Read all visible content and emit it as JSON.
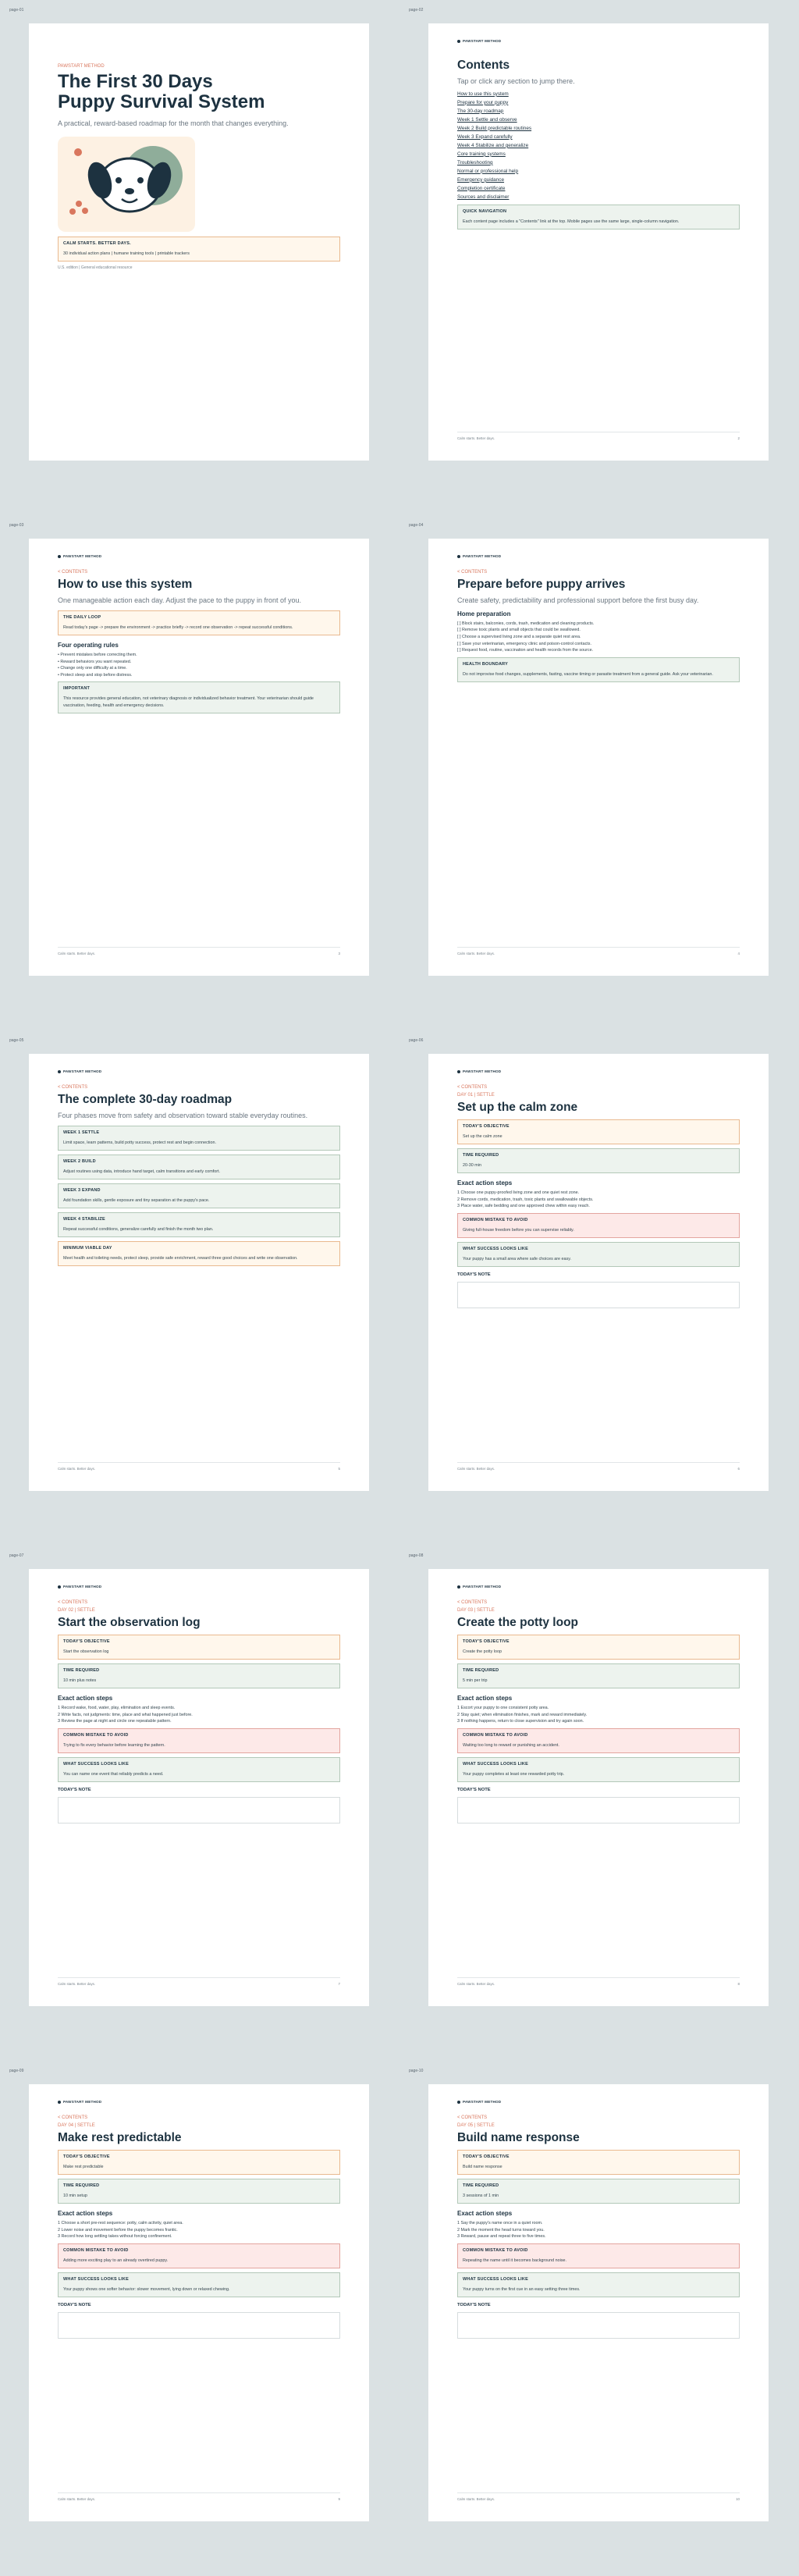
{
  "brand": "PAWSTART METHOD",
  "footer_left": "Calm starts. Better days.",
  "back_label": "< CONTENTS",
  "page_labels": [
    "page-01",
    "page-02",
    "page-03",
    "page-04",
    "page-05",
    "page-06",
    "page-07",
    "page-08",
    "page-09",
    "page-10"
  ],
  "cover": {
    "eyebrow": "PAWSTART METHOD",
    "title_line1": "The First 30 Days",
    "title_line2": "Puppy Survival System",
    "subtitle": "A practical, reward-based roadmap for the month that changes everything.",
    "callout_title": "CALM STARTS. BETTER DAYS.",
    "callout_body": "30 individual action plans | humane training tools | printable trackers",
    "edition": "U.S. edition | General educational resource"
  },
  "contents": {
    "title": "Contents",
    "subtitle": "Tap or click any section to jump there.",
    "items": [
      "How to use this system",
      "Prepare for your puppy",
      "The 30-day roadmap",
      "Week 1 Settle and observe",
      "Week 2 Build predictable routines",
      "Week 3 Expand carefully",
      "Week 4 Stabilize and generalize",
      "Core training systems",
      "Troubleshooting",
      "Normal or professional help",
      "Emergency guidance",
      "Completion certificate",
      "Sources and disclaimer"
    ],
    "box_title": "QUICK NAVIGATION",
    "box_body": "Each content page includes a \"Contents\" link at the top. Mobile pages use the same large, single-column navigation.",
    "page_num": "2"
  },
  "howto": {
    "title": "How to use this system",
    "subtitle": "One manageable action each day. Adjust the pace to the puppy in front of you.",
    "box1_title": "THE DAILY LOOP",
    "box1_body": "Read today's page -> prepare the environment -> practice briefly -> record one observation -> repeat successful conditions.",
    "rules_heading": "Four operating rules",
    "rules": [
      "Prevent mistakes before correcting them.",
      "Reward behaviors you want repeated.",
      "Change only one difficulty at a time.",
      "Protect sleep and stop before distress."
    ],
    "box2_title": "IMPORTANT",
    "box2_body": "This resource provides general education, not veterinary diagnosis or individualized behavior treatment. Your veterinarian should guide vaccination, feeding, health and emergency decisions.",
    "page_num": "3"
  },
  "prepare": {
    "title": "Prepare before puppy arrives",
    "subtitle": "Create safety, predictability and professional support before the first busy day.",
    "heading": "Home preparation",
    "items": [
      "Block stairs, balconies, cords, trash, medication and cleaning products.",
      "Remove toxic plants and small objects that could be swallowed.",
      "Choose a supervised living zone and a separate quiet rest area.",
      "Save your veterinarian, emergency clinic and poison-control contacts.",
      "Request food, routine, vaccination and health records from the source."
    ],
    "box_title": "HEALTH BOUNDARY",
    "box_body": "Do not improvise food changes, supplements, fasting, vaccine timing or parasite treatment from a general guide. Ask your veterinarian.",
    "page_num": "4"
  },
  "roadmap": {
    "title": "The complete 30-day roadmap",
    "subtitle": "Four phases move from safety and observation toward stable everyday routines.",
    "weeks": [
      {
        "title": "WEEK 1 SETTLE",
        "body": "Limit space, learn patterns, build potty success, protect rest and begin connection."
      },
      {
        "title": "WEEK 2 BUILD",
        "body": "Adjust routines using data, introduce hand target, calm transitions and early comfort."
      },
      {
        "title": "WEEK 3 EXPAND",
        "body": "Add foundation skills, gentle exposure and tiny separation at the puppy's pace."
      },
      {
        "title": "WEEK 4 STABILIZE",
        "body": "Repeat successful conditions, generalize carefully and finish the month two plan."
      }
    ],
    "min_title": "MINIMUM VIABLE DAY",
    "min_body": "Meet health and toileting needs, protect sleep, provide safe enrichment, reward three good choices and write one observation.",
    "page_num": "5"
  },
  "days": [
    {
      "day": "DAY 01 | SETTLE",
      "title": "Set up the calm zone",
      "objective": "Set up the calm zone",
      "time": "20-30 min",
      "steps": [
        "Choose one puppy-proofed living zone and one quiet rest zone.",
        "Remove cords, medication, trash, toxic plants and swallowable objects.",
        "Place water, safe bedding and one approved chew within easy reach."
      ],
      "mistake": "Giving full-house freedom before you can supervise reliably.",
      "success": "Your puppy has a small area where safe choices are easy.",
      "page_num": "6"
    },
    {
      "day": "DAY 02 | SETTLE",
      "title": "Start the observation log",
      "objective": "Start the observation log",
      "time": "10 min plus notes",
      "steps": [
        "Record wake, food, water, play, elimination and sleep events.",
        "Write facts, not judgments: time, place and what happened just before.",
        "Review the page at night and circle one repeatable pattern."
      ],
      "mistake": "Trying to fix every behavior before learning the pattern.",
      "success": "You can name one event that reliably predicts a need.",
      "page_num": "7"
    },
    {
      "day": "DAY 03 | SETTLE",
      "title": "Create the potty loop",
      "objective": "Create the potty loop",
      "time": "5 min per trip",
      "steps": [
        "Escort your puppy to one consistent potty area.",
        "Stay quiet; when elimination finishes, mark and reward immediately.",
        "If nothing happens, return to close supervision and try again soon."
      ],
      "mistake": "Waiting too long to reward or punishing an accident.",
      "success": "Your puppy completes at least one rewarded potty trip.",
      "page_num": "8"
    },
    {
      "day": "DAY 04 | SETTLE",
      "title": "Make rest predictable",
      "objective": "Make rest predictable",
      "time": "10 min setup",
      "steps": [
        "Choose a short pre-rest sequence: potty, calm activity, quiet area.",
        "Lower noise and movement before the puppy becomes frantic.",
        "Record how long settling takes without forcing confinement."
      ],
      "mistake": "Adding more exciting play to an already overtired puppy.",
      "success": "Your puppy shows one softer behavior: slower movement, lying down or relaxed chewing.",
      "page_num": "9"
    },
    {
      "day": "DAY 05 | SETTLE",
      "title": "Build name response",
      "objective": "Build name response",
      "time": "3 sessions of 1 min",
      "steps": [
        "Say the puppy's name once in a quiet room.",
        "Mark the moment the head turns toward you.",
        "Reward, pause and repeat three to five times."
      ],
      "mistake": "Repeating the name until it becomes background noise.",
      "success": "Your puppy turns on the first cue in an easy setting three times.",
      "page_num": "10"
    }
  ],
  "labels": {
    "objective": "TODAY'S OBJECTIVE",
    "time": "TIME REQUIRED",
    "steps": "Exact action steps",
    "mistake": "COMMON MISTAKE TO AVOID",
    "success": "WHAT SUCCESS LOOKS LIKE",
    "note": "TODAY'S NOTE"
  },
  "colors": {
    "navy": "#1d3240",
    "accent": "#d9775e",
    "sage": "#8fad9a"
  }
}
